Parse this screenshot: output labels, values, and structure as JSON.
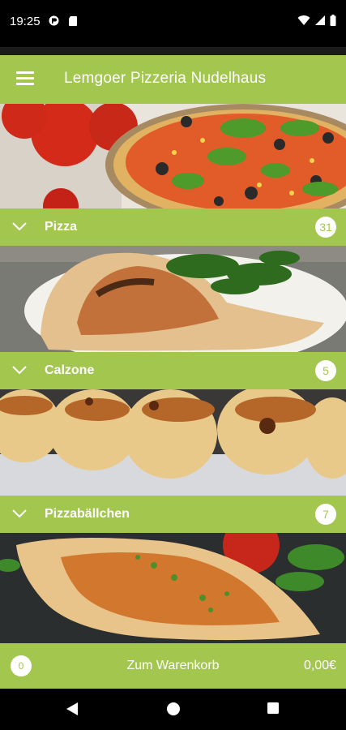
{
  "status_bar": {
    "time": "19:25"
  },
  "app_bar": {
    "title": "Lemgoer Pizzeria Nudelhaus",
    "menu_icon": "hamburger-menu-icon"
  },
  "categories": [
    {
      "label": "Pizza",
      "count": "31"
    },
    {
      "label": "Calzone",
      "count": "5"
    },
    {
      "label": "Pizzabällchen",
      "count": "7"
    }
  ],
  "cart": {
    "item_count": "0",
    "label": "Zum Warenkorb",
    "total": "0,00€"
  },
  "colors": {
    "accent": "#a3c64f",
    "status_bar": "#000000",
    "nav_bar": "#000000"
  },
  "nav_bar": {
    "icons": [
      "back-icon",
      "home-icon",
      "recents-icon"
    ]
  }
}
